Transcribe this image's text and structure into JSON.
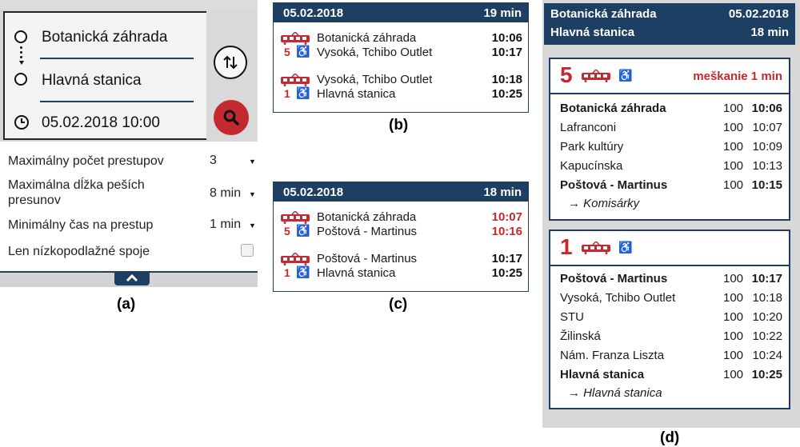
{
  "colors": {
    "brand": "#1d3f63",
    "accent": "#c4292f",
    "panel_bg": "#d8d8d8"
  },
  "captions": {
    "a": "(a)",
    "b": "(b)",
    "c": "(c)",
    "d": "(d)"
  },
  "panel_a": {
    "from": "Botanická záhrada",
    "to": "Hlavná stanica",
    "datetime": "05.02.2018 10:00",
    "swap_icon": "swap-arrows-icon",
    "search_icon": "search-icon",
    "options": [
      {
        "label": "Maximálny počet prestupov",
        "value": "3"
      },
      {
        "label": "Maximálna dĺžka peších presunov",
        "value": "8 min"
      },
      {
        "label": "Minimálny čas na prestup",
        "value": "1 min"
      },
      {
        "label": "Len nízkopodlažné spoje",
        "checked": false
      }
    ],
    "collapse_icon": "chevron-up-icon"
  },
  "panel_b": {
    "date": "05.02.2018",
    "duration": "19 min",
    "legs": [
      {
        "line": "5",
        "from": "Botanická záhrada",
        "dep": "10:06",
        "to": "Vysoká, Tchibo Outlet",
        "arr": "10:17"
      },
      {
        "line": "1",
        "from": "Vysoká, Tchibo Outlet",
        "dep": "10:18",
        "to": "Hlavná stanica",
        "arr": "10:25"
      }
    ]
  },
  "panel_c": {
    "date": "05.02.2018",
    "duration": "18 min",
    "legs": [
      {
        "line": "5",
        "from": "Botanická záhrada",
        "dep": "10:07",
        "to": "Poštová - Martinus",
        "arr": "10:16",
        "late": true
      },
      {
        "line": "1",
        "from": "Poštová - Martinus",
        "dep": "10:17",
        "to": "Hlavná stanica",
        "arr": "10:25",
        "late": false
      }
    ]
  },
  "panel_d": {
    "from": "Botanická záhrada",
    "to": "Hlavná stanica",
    "date": "05.02.2018",
    "duration": "18 min",
    "segments": [
      {
        "line": "5",
        "delay": "meškanie 1 min",
        "direction": "→ Komisárky",
        "stops": [
          {
            "name": "Botanická záhrada",
            "code": "100",
            "time": "10:06",
            "bold": true
          },
          {
            "name": "Lafranconi",
            "code": "100",
            "time": "10:07",
            "bold": false
          },
          {
            "name": "Park kultúry",
            "code": "100",
            "time": "10:09",
            "bold": false
          },
          {
            "name": "Kapucínska",
            "code": "100",
            "time": "10:13",
            "bold": false
          },
          {
            "name": "Poštová - Martinus",
            "code": "100",
            "time": "10:15",
            "bold": true
          }
        ]
      },
      {
        "line": "1",
        "delay": "",
        "direction": "→ Hlavná stanica",
        "stops": [
          {
            "name": "Poštová - Martinus",
            "code": "100",
            "time": "10:17",
            "bold": true
          },
          {
            "name": "Vysoká, Tchibo Outlet",
            "code": "100",
            "time": "10:18",
            "bold": false
          },
          {
            "name": "STU",
            "code": "100",
            "time": "10:20",
            "bold": false
          },
          {
            "name": "Žilinská",
            "code": "100",
            "time": "10:22",
            "bold": false
          },
          {
            "name": "Nám. Franza Liszta",
            "code": "100",
            "time": "10:24",
            "bold": false
          },
          {
            "name": "Hlavná stanica",
            "code": "100",
            "time": "10:25",
            "bold": true
          }
        ]
      }
    ]
  }
}
